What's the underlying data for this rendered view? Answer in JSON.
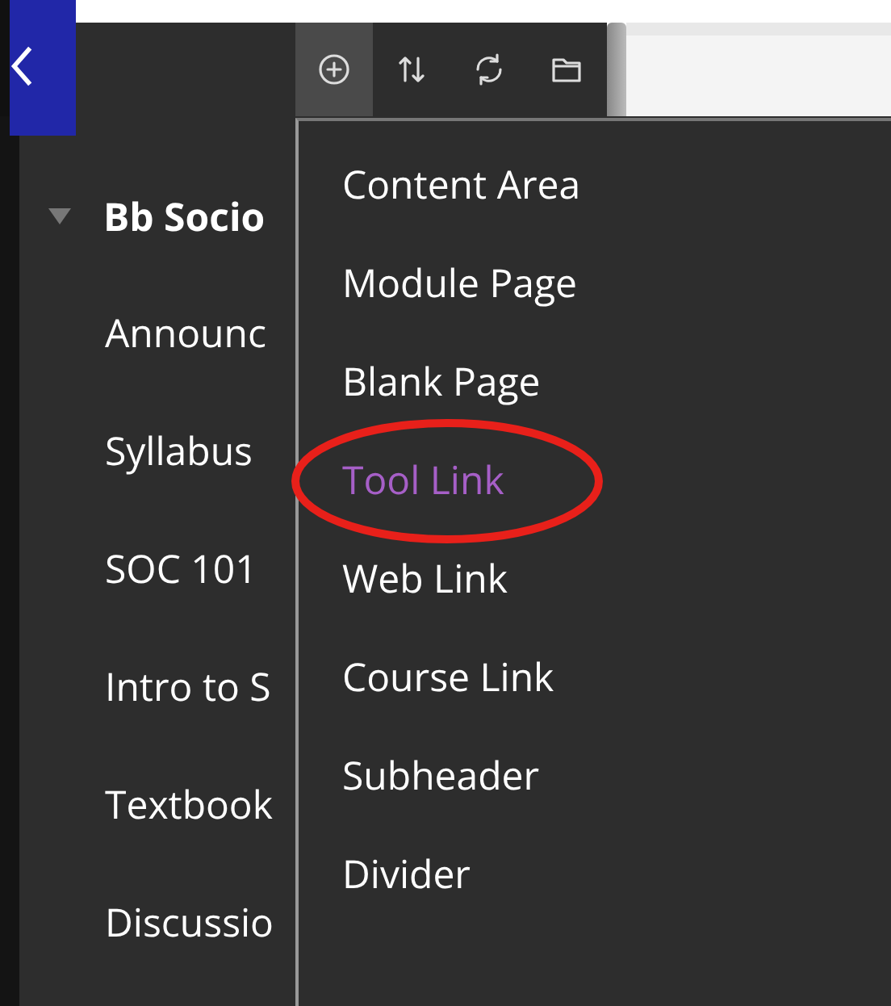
{
  "toolbar": [
    {
      "kind": "add",
      "selected": true
    },
    {
      "kind": "sort",
      "selected": false
    },
    {
      "kind": "refresh",
      "selected": false
    },
    {
      "kind": "folder",
      "selected": false
    }
  ],
  "sidebar": {
    "title": "Bb Socio",
    "expanded": true,
    "items": [
      "Announc",
      "Syllabus",
      "SOC 101",
      "Intro to S",
      "Textbook",
      "Discussio"
    ]
  },
  "menu": {
    "groups": [
      [
        {
          "label": "Content Area",
          "highlighted": false
        },
        {
          "label": "Module Page",
          "highlighted": false
        },
        {
          "label": "Blank Page",
          "highlighted": false
        }
      ],
      [
        {
          "label": "Tool Link",
          "highlighted": true,
          "circled": true
        },
        {
          "label": "Web Link",
          "highlighted": false
        },
        {
          "label": "Course Link",
          "highlighted": false
        }
      ],
      [
        {
          "label": "Subheader",
          "highlighted": false
        },
        {
          "label": "Divider",
          "highlighted": false
        }
      ]
    ]
  },
  "annotation": {
    "color": "#e8201a"
  }
}
